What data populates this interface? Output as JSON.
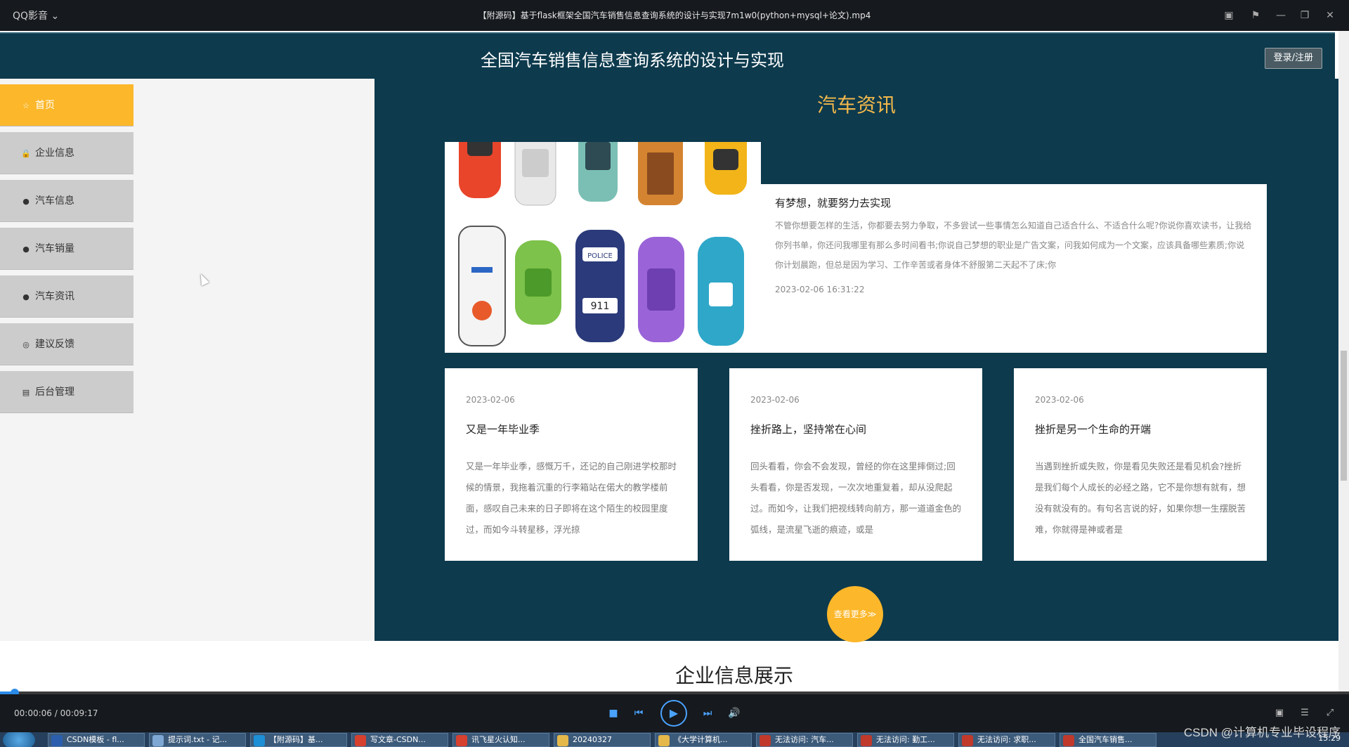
{
  "player": {
    "app_name": "QQ影音",
    "file_name": "【附源码】基于flask框架全国汽车销售信息查询系统的设计与实现7m1w0(python+mysql+论文).mp4",
    "time_display": "00:00:06 / 00:09:17",
    "progress": 0.011
  },
  "site": {
    "title": "全国汽车销售信息查询系统的设计与实现",
    "login_label": "登录/注册"
  },
  "sidebar": {
    "items": [
      {
        "label": "首页",
        "icon": "star-icon",
        "active": true
      },
      {
        "label": "企业信息",
        "icon": "lock-icon"
      },
      {
        "label": "汽车信息",
        "icon": "exclamation-icon"
      },
      {
        "label": "汽车销量",
        "icon": "question-icon"
      },
      {
        "label": "汽车资讯",
        "icon": "info-icon"
      },
      {
        "label": "建议反馈",
        "icon": "circle-icon"
      },
      {
        "label": "后台管理",
        "icon": "calendar-icon"
      }
    ]
  },
  "news": {
    "heading": "汽车资讯",
    "featured": {
      "title": "有梦想，就要努力去实现",
      "excerpt": "不管你想要怎样的生活，你都要去努力争取，不多尝试一些事情怎么知道自己适合什么、不适合什么呢?你说你喜欢读书，让我给你列书单，你还问我哪里有那么多时间看书;你说自己梦想的职业是广告文案，问我如何成为一个文案，应该具备哪些素质;你说你计划晨跑，但总是因为学习、工作辛苦或者身体不舒服第二天起不了床;你",
      "time": "2023-02-06 16:31:22"
    },
    "cards": [
      {
        "date": "2023-02-06",
        "title": "又是一年毕业季",
        "excerpt": "又是一年毕业季，感慨万千，还记的自己刚进学校那时候的情景，我拖着沉重的行李箱站在偌大的教学楼前面，感叹自己未来的日子即将在这个陌生的校园里度过，而如今斗转星移，浮光掠"
      },
      {
        "date": "2023-02-06",
        "title": "挫折路上，坚持常在心间",
        "excerpt": "回头看看，你会不会发现，曾经的你在这里摔倒过;回头看看，你是否发现，一次次地重复着，却从没爬起过。而如今，让我们把视线转向前方，那一道道金色的弧线，是流星飞逝的痕迹，或是"
      },
      {
        "date": "2023-02-06",
        "title": "挫折是另一个生命的开端",
        "excerpt": "当遇到挫折或失败，你是看见失败还是看见机会?挫折是我们每个人成长的必经之路，它不是你想有就有，想没有就没有的。有句名言说的好，如果你想一生摆脱苦难，你就得是神或者是"
      }
    ],
    "more_label": "查看更多≫"
  },
  "company_heading": "企业信息展示",
  "taskbar": {
    "items": [
      {
        "label": "CSDN模板 - fl...",
        "color": "#2b5fae"
      },
      {
        "label": "提示词.txt - 记...",
        "color": "#7fa7d4"
      },
      {
        "label": "【附源码】基...",
        "color": "#1c8fd6"
      },
      {
        "label": "写文章-CSDN...",
        "color": "#d6402f"
      },
      {
        "label": "讯飞星火认知...",
        "color": "#d6402f"
      },
      {
        "label": "20240327",
        "color": "#e5b84a"
      },
      {
        "label": "《大学计算机...",
        "color": "#e5b84a"
      },
      {
        "label": "无法访问: 汽车...",
        "color": "#c0392b"
      },
      {
        "label": "无法访问: 勤工...",
        "color": "#c0392b"
      },
      {
        "label": "无法访问: 求职...",
        "color": "#c0392b"
      },
      {
        "label": "全国汽车销售...",
        "color": "#c0392b"
      }
    ],
    "clock": "15:29"
  },
  "watermark": "CSDN @计算机专业毕设程序"
}
